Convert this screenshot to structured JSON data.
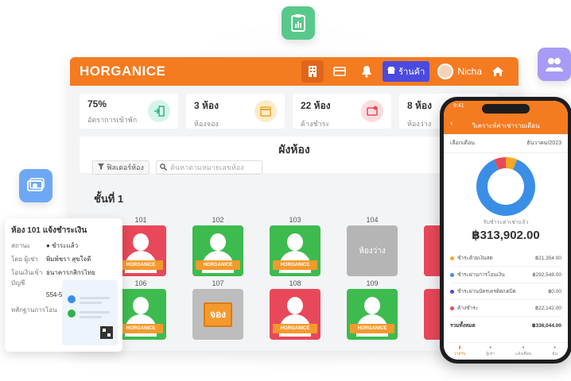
{
  "colors": {
    "brand": "#f47b20",
    "occupied": "#e8485a",
    "available": "#3dbb4f",
    "vacant": "#b5b5b5",
    "booked": "#f49a2d"
  },
  "topbar": {
    "logo": "HORGANICE",
    "shop_label": "ร้านค้า",
    "user_name": "Nicha"
  },
  "stats": [
    {
      "value": "75%",
      "label": "อัตราการเข้าพัก"
    },
    {
      "value": "3 ห้อง",
      "label": "ห้องจอง"
    },
    {
      "value": "22 ห้อง",
      "label": "ค้างชำระ"
    },
    {
      "value": "8 ห้อง",
      "label": "ห้องว่าง"
    }
  ],
  "panel": {
    "title": "ผังห้อง",
    "filter_label": "ฟิลเตอร์ห้อง",
    "search_placeholder": "ค้นหาตามหมายเลขห้อง"
  },
  "floor": {
    "label": "ชั้นที่ 1"
  },
  "rooms": [
    {
      "number": "101",
      "status": "occupied",
      "brand": "HORGANICE"
    },
    {
      "number": "102",
      "status": "available",
      "brand": "HORGANICE"
    },
    {
      "number": "103",
      "status": "available",
      "brand": "HORGANICE"
    },
    {
      "number": "104",
      "status": "vacant",
      "label": "ห้องว่าง"
    },
    {
      "number": "106",
      "status": "available",
      "brand": "HORGANICE"
    },
    {
      "number": "107",
      "status": "booked",
      "label": "จอง"
    },
    {
      "number": "108",
      "status": "occupied",
      "brand": "HORGANICE"
    },
    {
      "number": "109",
      "status": "available",
      "brand": "HORGANICE"
    }
  ],
  "card": {
    "title": "ห้อง 101 แจ้งชำระเงิน",
    "status_key": "สถานะ",
    "status_value": "ชำระแล้ว",
    "by_key": "โดย ผู้เช่า",
    "by_value": "พิมพ์ชรา สุขใจดี",
    "account_key": "โอนเงินเข้าบัญชี",
    "bank": "ธนาคารกสิกรไทย",
    "account_no": "554-5-24424-5",
    "proof_key": "หลักฐานการโอน"
  },
  "phone": {
    "time": "9:41",
    "title": "วิเคราะห์ค่าเช่ารายเดือน",
    "month_key": "เลือกเดือน",
    "month_value": "ธันวาคม/2023",
    "caption": "รับชำระค่าเช่าแล้ว",
    "total": "฿313,902.00",
    "legend": [
      {
        "label": "ชำระด้วยเงินสด",
        "value": "฿21,354.00",
        "color": "#f5a623"
      },
      {
        "label": "ชำระผ่านการโอนเงิน",
        "value": "฿292,548.00",
        "color": "#3a8ee6"
      },
      {
        "label": "ชำระผ่านบัตรเครดิต/เดบิต",
        "value": "฿0.00",
        "color": "#4a4ae0"
      },
      {
        "label": "ค้างชำระ",
        "value": "฿22,142.00",
        "color": "#e8485a"
      }
    ],
    "sum_label": "รวมทั้งหมด",
    "sum_value": "฿336,044.00",
    "tabs": [
      "รายรับ",
      "ผู้เช่า",
      "แจ้งเตือน",
      "ฉัน"
    ]
  },
  "chart_data": {
    "type": "pie",
    "categories": [
      "ชำระด้วยเงินสด",
      "ชำระผ่านการโอนเงิน",
      "ชำระผ่านบัตรเครดิต/เดบิต",
      "ค้างชำระ"
    ],
    "values": [
      21354,
      292548,
      0,
      22142
    ]
  }
}
